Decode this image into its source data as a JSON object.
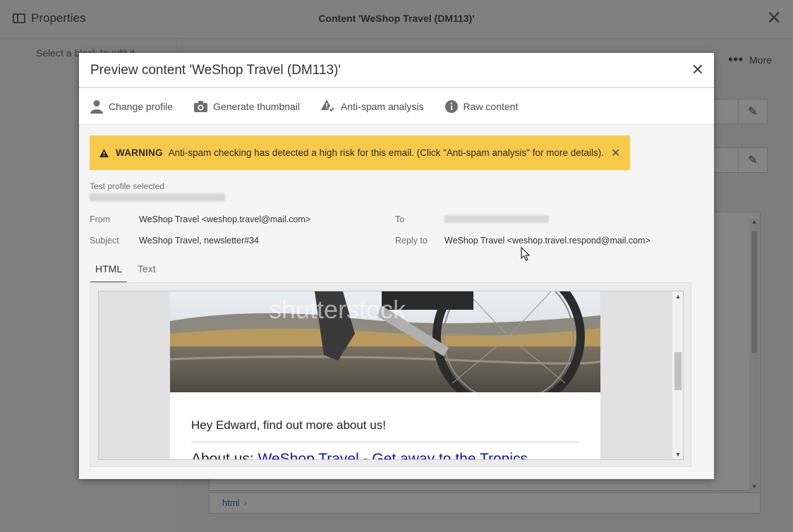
{
  "app": {
    "properties_label": "Properties",
    "title": "Content 'WeShop Travel (DM113)'",
    "left_hint": "Select a block to edit it",
    "more_label": "More",
    "breadcrumb": "html"
  },
  "modal": {
    "title": "Preview content 'WeShop Travel (DM113)'",
    "toolbar": {
      "change_profile": "Change profile",
      "generate_thumbnail": "Generate thumbnail",
      "anti_spam": "Anti-spam analysis",
      "raw_content": "Raw content"
    },
    "warning": {
      "label": "WARNING",
      "message": "Anti-spam checking has detected a high risk for this email. (Click \"Anti-spam analysis\" for more details).",
      "color": "#f9c94b"
    },
    "test_profile_label": "Test profile selected",
    "headers": {
      "from_label": "From",
      "from_value": "WeShop Travel <weshop.travel@mail.com>",
      "to_label": "To",
      "subject_label": "Subject",
      "subject_value": "WeShop Travel, newsletter#34",
      "reply_to_label": "Reply to",
      "reply_to_value": "WeShop Travel <weshop.travel.respond@mail.com>"
    },
    "tabs": [
      {
        "label": "HTML",
        "active": true
      },
      {
        "label": "Text",
        "active": false
      }
    ],
    "email": {
      "watermark": "shutterstock",
      "greeting": "Hey Edward, find out more about us!",
      "about_prefix": "About us:",
      "about_link": "WeShop Travel - Get away to the Tropics"
    }
  }
}
